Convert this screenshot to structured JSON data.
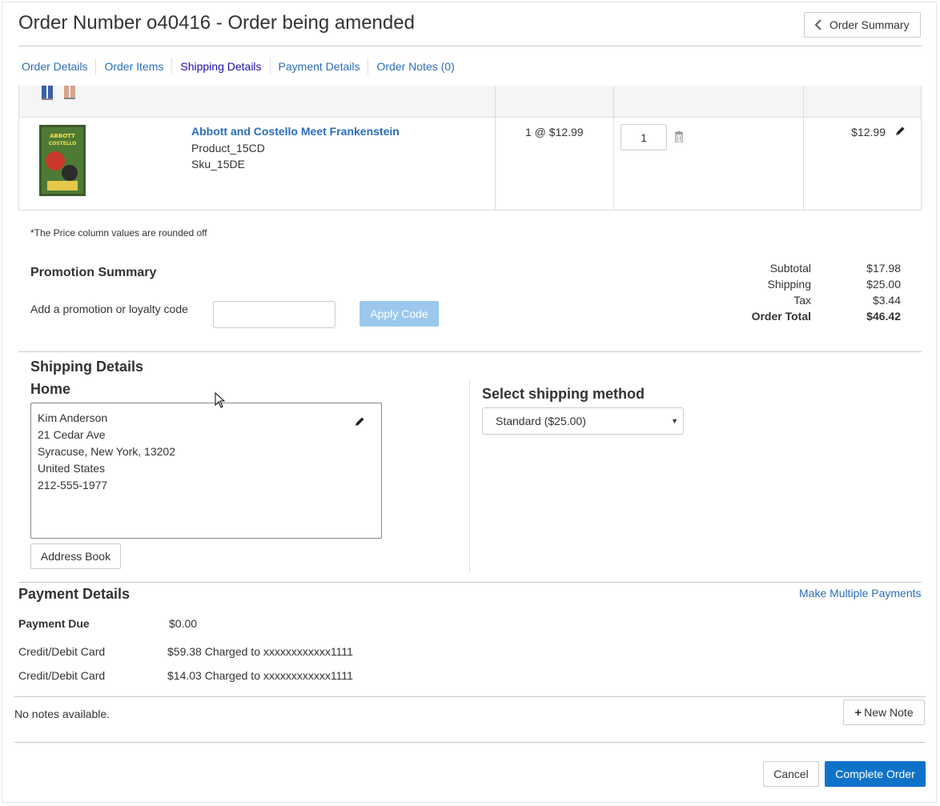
{
  "header": {
    "title": "Order Number o40416 - Order being amended",
    "summary_button": "Order Summary"
  },
  "tabs": [
    {
      "label": "Order Details"
    },
    {
      "label": "Order Items"
    },
    {
      "label": "Shipping Details"
    },
    {
      "label": "Payment Details"
    },
    {
      "label": "Order Notes (0)"
    }
  ],
  "item": {
    "name": "Abbott and Costello Meet Frankenstein",
    "product": "Product_15CD",
    "sku": "Sku_15DE",
    "unit_price": "1 @ $12.99",
    "quantity": "1",
    "total": "$12.99",
    "poster_text": "ABBOTT COSTELLO MEET FRANKENSTEIN"
  },
  "price_note": "*The Price column values are rounded off",
  "promotion": {
    "heading": "Promotion Summary",
    "label": "Add a promotion or loyalty code",
    "input_value": "",
    "apply_button": "Apply Code"
  },
  "totals": {
    "subtotal_label": "Subtotal",
    "subtotal": "$17.98",
    "shipping_label": "Shipping",
    "shipping": "$25.00",
    "tax_label": "Tax",
    "tax": "$3.44",
    "total_label": "Order Total",
    "total": "$46.42"
  },
  "shipping": {
    "heading": "Shipping Details",
    "address_label": "Home",
    "address": {
      "name": "Kim Anderson",
      "street": "21 Cedar Ave",
      "city": "Syracuse, New York, 13202",
      "country": "United States",
      "phone": "212-555-1977"
    },
    "address_book_button": "Address Book",
    "method_heading": "Select shipping method",
    "method_selected": "Standard ($25.00)"
  },
  "payment": {
    "heading": "Payment Details",
    "multiple_link": "Make Multiple Payments",
    "due_label": "Payment Due",
    "due_value": "$0.00",
    "lines": [
      {
        "method": "Credit/Debit Card",
        "detail": "$59.38 Charged to xxxxxxxxxxxx1111"
      },
      {
        "method": "Credit/Debit Card",
        "detail": "$14.03 Charged to xxxxxxxxxxxx1111"
      }
    ]
  },
  "notes": {
    "empty_text": "No notes available.",
    "new_note_button": "New Note"
  },
  "footer": {
    "cancel_button": "Cancel",
    "complete_button": "Complete Order"
  },
  "colors": {
    "link": "#2a6ebb",
    "primary": "#0f72c9",
    "apply_disabled": "#9cc8ee"
  }
}
